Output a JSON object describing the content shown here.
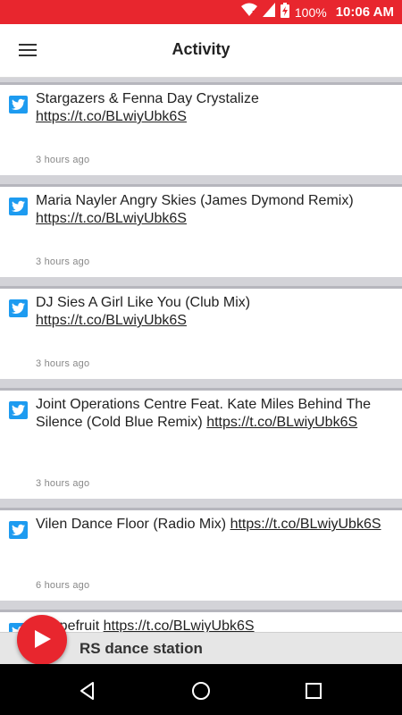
{
  "status_bar": {
    "battery_percent": "100%",
    "time": "10:06 AM",
    "icons": [
      "wifi-icon",
      "signal-icon",
      "battery-charging-icon"
    ]
  },
  "app_bar": {
    "title": "Activity",
    "menu_icon": "hamburger-menu-icon"
  },
  "feed": {
    "items": [
      {
        "text": "Stargazers & Fenna Day Crystalize ",
        "link": "https://t.co/BLwiyUbk6S",
        "time": "3 hours ago",
        "icon": "twitter-icon"
      },
      {
        "text": "Maria Nayler Angry Skies (James Dymond Remix) ",
        "link": "https://t.co/BLwiyUbk6S",
        "time": "3 hours ago",
        "icon": "twitter-icon"
      },
      {
        "text": "DJ Sies A Girl Like You (Club Mix) ",
        "link": "https://t.co/BLwiyUbk6S",
        "time": "3 hours ago",
        "icon": "twitter-icon"
      },
      {
        "text": "Joint Operations Centre Feat. Kate Miles Behind The Silence (Cold Blue Remix) ",
        "link": "https://t.co/BLwiyUbk6S",
        "time": "3 hours ago",
        "icon": "twitter-icon"
      },
      {
        "text": "Vilen Dance Floor (Radio Mix) ",
        "link": "https://t.co/BLwiyUbk6S",
        "time": "6 hours ago",
        "icon": "twitter-icon"
      },
      {
        "text": "Grapefruit ",
        "link": "https://t.co/BLwiyUbk6S",
        "time": "",
        "icon": "twitter-icon"
      }
    ]
  },
  "player": {
    "station_name": "RS dance station",
    "play_icon": "play-icon"
  },
  "nav_bar": {
    "buttons": [
      "back-icon",
      "home-icon",
      "recents-icon"
    ]
  },
  "colors": {
    "accent": "#e8262e",
    "twitter": "#1d9bf0",
    "background": "#d3d3d8"
  }
}
